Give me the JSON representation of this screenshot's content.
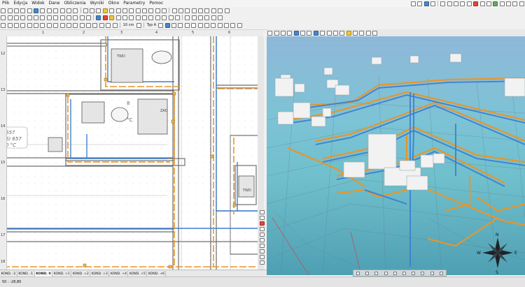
{
  "menu": [
    "Plik",
    "Edycja",
    "Widok",
    "Dane",
    "Obliczenia",
    "Wyniki",
    "Okno",
    "Parametry",
    "Pomoc"
  ],
  "toolbar": {
    "zoom_value": "10 cm",
    "type_label": "Typ A"
  },
  "ruler_top": [
    "1",
    "2",
    "3",
    "4",
    "5",
    "6"
  ],
  "ruler_left": [
    "12",
    "13",
    "14",
    "15",
    "16",
    "17",
    "18"
  ],
  "plan_labels": {
    "label1": "TWD",
    "label2": "8",
    "label3": "ZAD",
    "label4": "657",
    "label5": "6) 657",
    "label6": "0 °C",
    "label7": "°C",
    "label8": "TWD"
  },
  "floor_tabs": [
    "KOND. -2",
    "KOND. -1",
    "KOND. 0",
    "KOND. +1",
    "KOND. +2",
    "KOND. +3",
    "KOND. +4",
    "KOND. +5",
    "KOND. +6"
  ],
  "status": {
    "coords": "50 : -28,80"
  },
  "compass": {
    "n": "N",
    "e": "E",
    "s": "S",
    "w": "W"
  },
  "colors": {
    "pipe_blue": "#3d7fd1",
    "pipe_orange": "#e7962a",
    "water_3d": "#6fbfcc"
  },
  "icons": [
    "new-file-icon",
    "open-icon",
    "save-icon",
    "print-icon",
    "undo-icon",
    "redo-icon",
    "cut-icon",
    "copy-icon",
    "paste-icon",
    "zoom-icon",
    "compass-icon"
  ]
}
